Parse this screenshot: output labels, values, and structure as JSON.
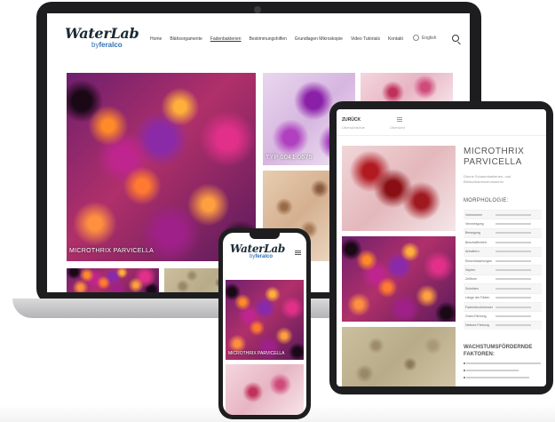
{
  "laptop": {
    "logo": {
      "main": "WaterLab",
      "sub_prefix": "by",
      "sub_brand": "feralco"
    },
    "nav": [
      "Home",
      "Blähsorgamente",
      "Fadenbakterien",
      "Bestimmungshilfen",
      "Grundlagen Mikroskopie",
      "Video Tutorials",
      "Kontakt"
    ],
    "nav_active_index": 2,
    "language": "English",
    "tiles": [
      {
        "caption": "MICROTHRIX PARVICELLA"
      },
      {
        "caption": "TYP 0041-0675"
      },
      {
        "caption": ""
      },
      {
        "caption": ""
      },
      {
        "caption": ""
      },
      {
        "caption": ""
      }
    ]
  },
  "tablet": {
    "back_label": "ZURÜCK",
    "back_sub": "Übersichtslinie",
    "overview_label": "Übersicht",
    "title": "MICROTHRIX PARVICELLA",
    "description": "Dünne Schaumbakterien- und Blähschlammverursacher",
    "morphology_heading": "MORPHOLOGIE:",
    "morphology_rows": [
      "Vorkommen",
      "Verzweigung",
      "Bewegung",
      "Beschaffenheit",
      "Anhaftern",
      "Einschlüsse/ungen",
      "Septen",
      "Zellform",
      "Scheiden",
      "Länge der Fäden",
      "Fadendurchmesser",
      "Gram-Färbung",
      "Neisser-Färbung"
    ],
    "factors_heading": "WACHSTUMSFÖRDERNDE FAKTOREN:"
  },
  "phone": {
    "logo": {
      "main": "WaterLab",
      "sub_prefix": "by",
      "sub_brand": "feralco"
    },
    "tiles": [
      {
        "caption": "MICROTHRIX PARVICELLA"
      },
      {
        "caption": ""
      }
    ]
  }
}
